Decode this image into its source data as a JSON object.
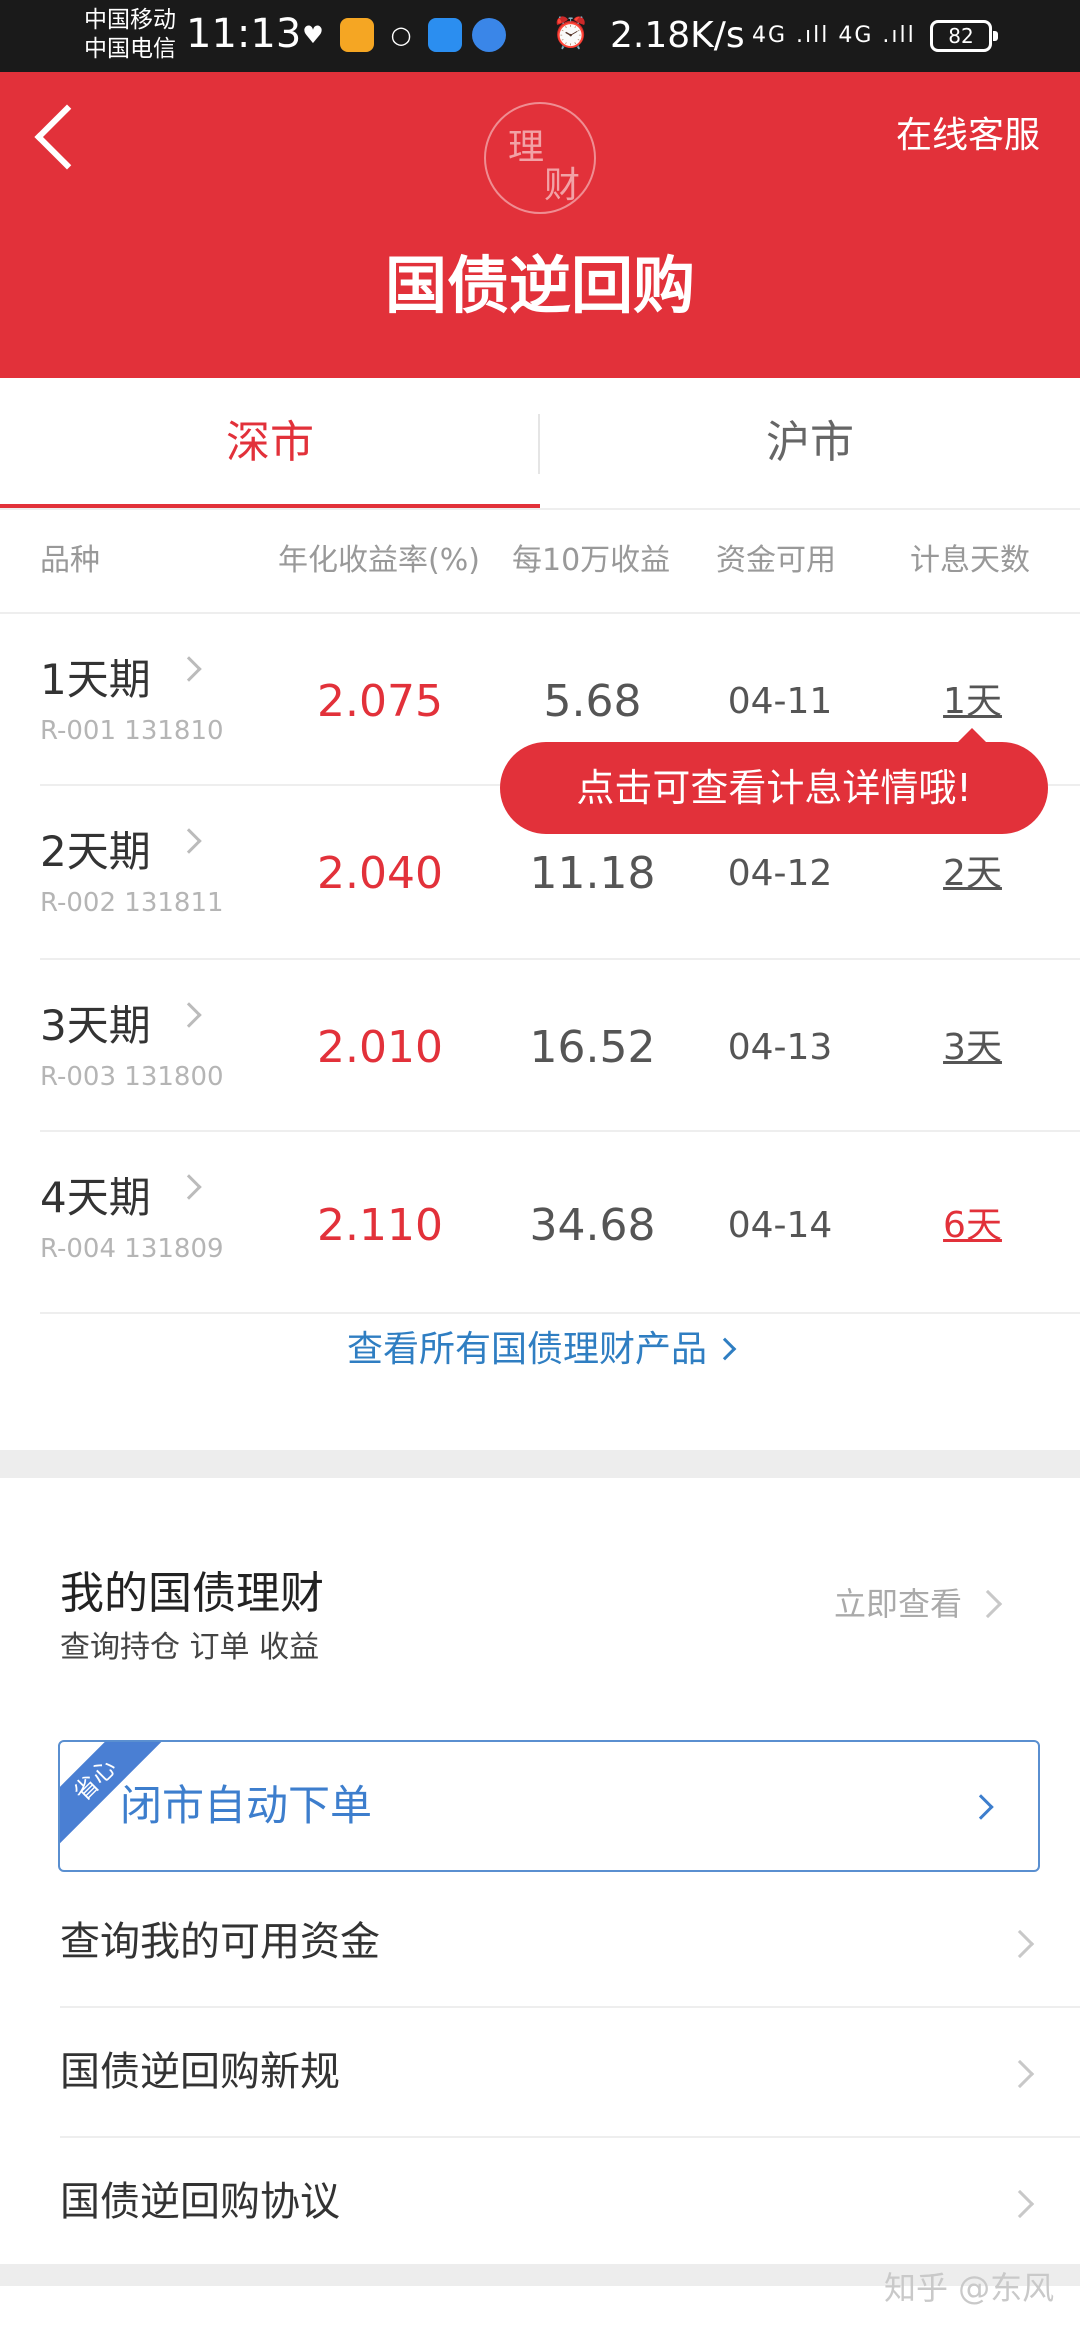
{
  "status_bar": {
    "carrier1": "中国移动",
    "carrier2": "中国电信",
    "time": "11:13",
    "net_speed": "2.18K/s",
    "signal": "4G .ıll 4G .ıll",
    "battery": "82"
  },
  "header": {
    "logo_char1": "理",
    "logo_char2": "财",
    "service_label": "在线客服",
    "title": "国债逆回购"
  },
  "tabs": [
    {
      "label": "深市",
      "active": true
    },
    {
      "label": "沪市",
      "active": false
    }
  ],
  "table": {
    "headers": [
      "品种",
      "年化收益率(%)",
      "每10万收益",
      "资金可用",
      "计息天数"
    ],
    "rows": [
      {
        "term": "1天期",
        "code": "R-001 131810",
        "rate": "2.075",
        "income": "5.68",
        "available": "04-11",
        "days": "1天"
      },
      {
        "term": "2天期",
        "code": "R-002 131811",
        "rate": "2.040",
        "income": "11.18",
        "available": "04-12",
        "days": "2天"
      },
      {
        "term": "3天期",
        "code": "R-003 131800",
        "rate": "2.010",
        "income": "16.52",
        "available": "04-13",
        "days": "3天"
      },
      {
        "term": "4天期",
        "code": "R-004 131809",
        "rate": "2.110",
        "income": "34.68",
        "available": "04-14",
        "days": "6天"
      }
    ],
    "tooltip": "点击可查看计息详情哦!",
    "view_all": "查看所有国债理财产品"
  },
  "my_section": {
    "title": "我的国债理财",
    "subtitle": "查询持仓 订单 收益",
    "view_now": "立即查看",
    "auto_order_badge": "省心",
    "auto_order_label": "闭市自动下单",
    "menu": [
      {
        "label": "查询我的可用资金"
      },
      {
        "label": "国债逆回购新规"
      },
      {
        "label": "国债逆回购协议"
      }
    ]
  },
  "watermark": "知乎 @东风",
  "colors": {
    "brand_red": "#e2313a",
    "link_blue": "#2f7ec2",
    "card_blue": "#3d7ecd"
  }
}
